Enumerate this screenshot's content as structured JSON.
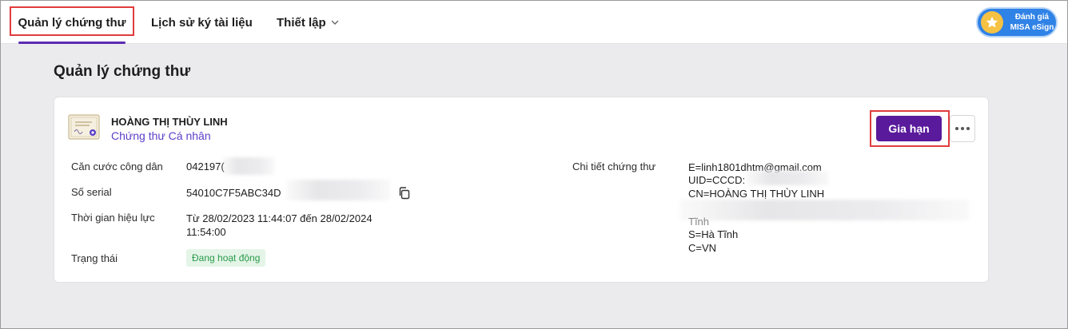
{
  "nav": {
    "tabs": [
      {
        "label": "Quản lý chứng thư"
      },
      {
        "label": "Lịch sử ký tài liệu"
      },
      {
        "label": "Thiết lập"
      }
    ],
    "rate": {
      "line1": "Đánh giá",
      "line2": "MISA eSign"
    }
  },
  "page": {
    "title": "Quản lý chứng thư"
  },
  "cert": {
    "holder_name": "HOÀNG THỊ THÙY LINH",
    "type": "Chứng thư Cá nhân",
    "renew_label": "Gia hạn",
    "fields": {
      "id_label": "Căn cước công dân",
      "id_value": "042197(",
      "serial_label": "Số serial",
      "serial_value": "54010C7F5ABC34D",
      "validity_label": "Thời gian hiệu lực",
      "validity_line1": "Từ 28/02/2023 11:44:07 đến 28/02/2024",
      "validity_line2": "11:54:00",
      "status_label": "Trạng thái",
      "status_value": "Đang hoạt động"
    },
    "details": {
      "label": "Chi tiết chứng thư",
      "lines": [
        "E=linh1801dhtm@gmail.com",
        "UID=CCCD:",
        "CN=HOÀNG THỊ THÙY LINH",
        "",
        "Tĩnh",
        "S=Hà Tĩnh",
        "C=VN"
      ]
    }
  },
  "colors": {
    "accent": "#5a1a9c",
    "highlight": "#e03c3c",
    "status_bg": "#e4f5e8",
    "status_fg": "#2a9a4b",
    "rate_bg": "#2f82e6"
  }
}
